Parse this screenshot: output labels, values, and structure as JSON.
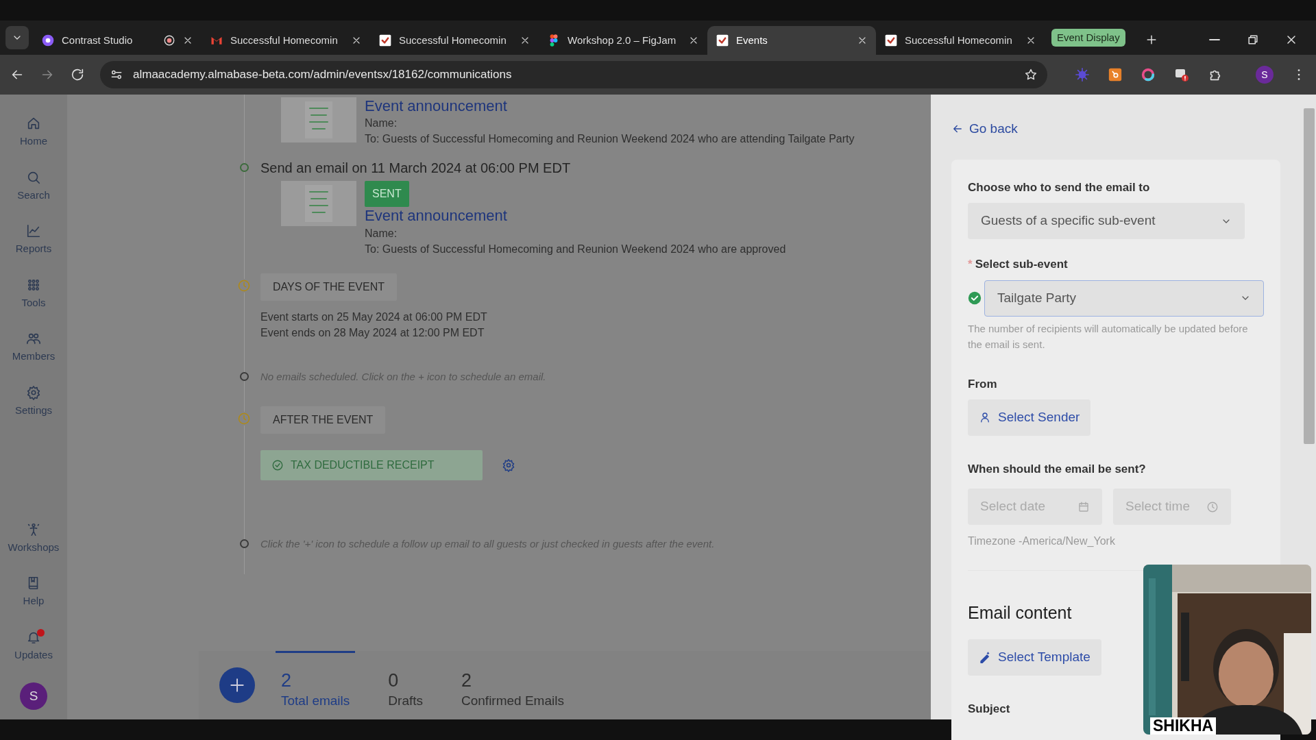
{
  "browser": {
    "tabs": [
      {
        "title": "Contrast Studio",
        "recording": true,
        "selected": false
      },
      {
        "title": "Successful Homecomin",
        "recording": false,
        "selected": false
      },
      {
        "title": "Successful Homecomin",
        "recording": false,
        "selected": false
      },
      {
        "title": "Workshop 2.0 – FigJam",
        "recording": false,
        "selected": false
      },
      {
        "title": "Events",
        "recording": false,
        "selected": true
      },
      {
        "title": "Successful Homecomin",
        "recording": false,
        "selected": false
      }
    ],
    "tab_group": "Event Display",
    "url": "almaacademy.almabase-beta.com/admin/eventsx/18162/communications",
    "profile_initial": "S"
  },
  "sidebar": {
    "items": [
      {
        "label": "Home",
        "badge": false
      },
      {
        "label": "Search",
        "badge": false
      },
      {
        "label": "Reports",
        "badge": false
      },
      {
        "label": "Tools",
        "badge": false
      },
      {
        "label": "Members",
        "badge": false
      },
      {
        "label": "Settings",
        "badge": false
      }
    ],
    "bottom_items": [
      {
        "label": "Workshops",
        "badge": false
      },
      {
        "label": "Help",
        "badge": false
      },
      {
        "label": "Updates",
        "badge": true
      }
    ],
    "avatar": "S"
  },
  "timeline": [
    {
      "kind": "email",
      "title": "Event announcement",
      "name_label": "Name:",
      "to": "To: Guests of Successful Homecoming and Reunion Weekend 2024 who are attending Tailgate Party"
    },
    {
      "kind": "email",
      "heading": "Send an email on 11 March 2024 at 06:00 PM EDT",
      "status": "SENT",
      "title": "Event announcement",
      "name_label": "Name:",
      "to": "To: Guests of Successful Homecoming and Reunion Weekend 2024 who are approved"
    },
    {
      "kind": "phase",
      "label": "DAYS OF THE EVENT",
      "lines": [
        "Event starts on 25 May 2024 at 06:00 PM EDT",
        "Event ends on 28 May 2024 at 12:00 PM EDT"
      ]
    },
    {
      "kind": "note",
      "text": "No emails scheduled. Click on the + icon to schedule an email."
    },
    {
      "kind": "phase",
      "label": "AFTER THE EVENT",
      "receipt": "TAX DEDUCTIBLE RECEIPT"
    },
    {
      "kind": "note",
      "text": "Click the '+' icon to schedule a follow up email to all guests or just checked in guests after the event."
    }
  ],
  "stats": [
    {
      "value": "2",
      "label": "Total emails",
      "selected": true
    },
    {
      "value": "0",
      "label": "Drafts",
      "selected": false
    },
    {
      "value": "2",
      "label": "Confirmed Emails",
      "selected": false
    }
  ],
  "panel": {
    "go_back": "Go back",
    "recipient": {
      "label": "Choose who to send the email to",
      "value": "Guests of a specific sub-event"
    },
    "sub_event": {
      "label": "Select sub-event",
      "required_mark": "*",
      "value": "Tailgate Party",
      "valid": true,
      "hint": "The number of recipients will automatically be updated before the email is sent."
    },
    "from": {
      "label": "From",
      "button": "Select Sender"
    },
    "schedule": {
      "label": "When should the email be sent?",
      "date_placeholder": "Select date",
      "time_placeholder": "Select time",
      "timezone": "Timezone -America/New_York"
    },
    "content": {
      "heading": "Email content",
      "button": "Select Template",
      "subject_label": "Subject"
    }
  },
  "webcam": {
    "kind": "picture",
    "name": "SHIKHA"
  }
}
